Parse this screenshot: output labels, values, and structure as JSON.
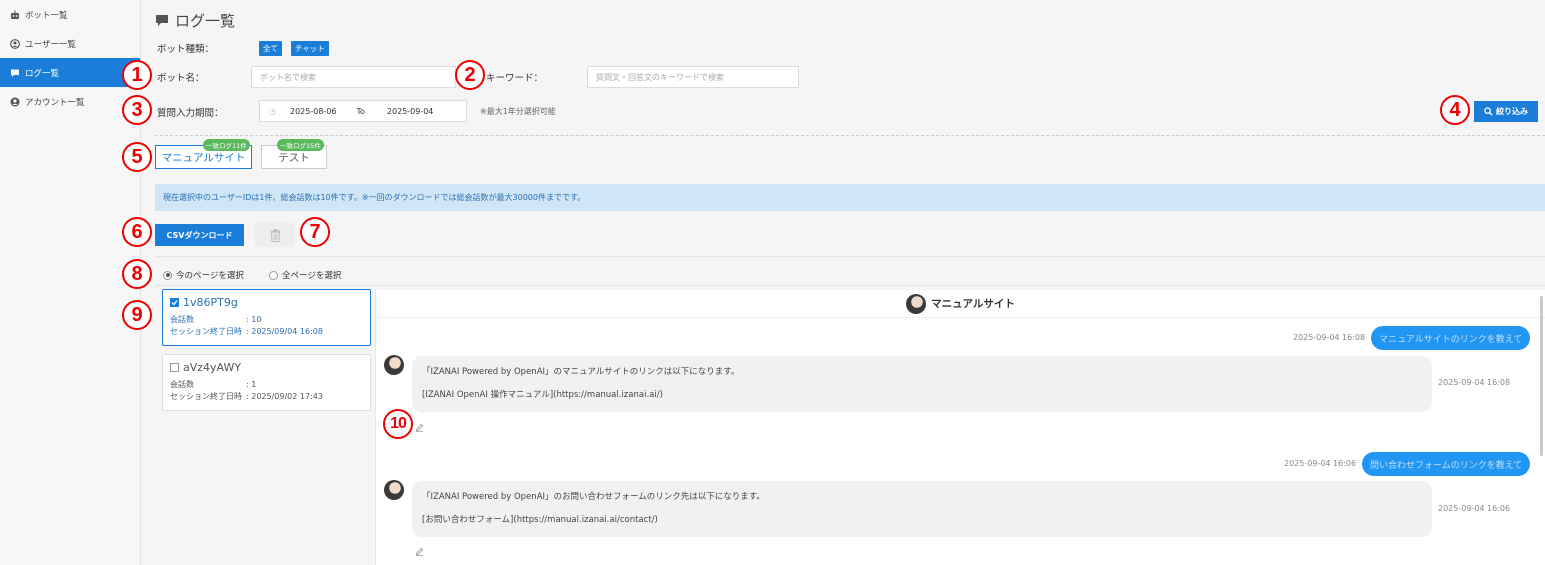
{
  "sidebar": {
    "items": [
      {
        "label": "ボット一覧",
        "icon": "robot-icon"
      },
      {
        "label": "ユーザー一覧",
        "icon": "user-circle-icon"
      },
      {
        "label": "ログ一覧",
        "icon": "comment-icon"
      },
      {
        "label": "アカウント一覧",
        "icon": "account-icon"
      }
    ]
  },
  "header": {
    "title": "ログ一覧"
  },
  "filters": {
    "bot_type_label": "ボット種類：",
    "bot_type_tags": [
      "全て",
      "チャット"
    ],
    "bot_name_label": "ボット名：",
    "bot_name_placeholder": "ボット名で検索",
    "keyword_label": "キーワード：",
    "keyword_placeholder": "質問文・回答文のキーワードで検索",
    "period_label": "質問入力期間：",
    "date_from": "2025-08-06",
    "date_to_word": "To",
    "date_to": "2025-09-04",
    "period_note": "※最大1年分選択可能",
    "search_button": "絞り込み"
  },
  "bot_tabs": [
    {
      "label": "マニュアルサイト",
      "badge": "一致ログ11件"
    },
    {
      "label": "テスト",
      "badge": "一致ログ15件"
    }
  ],
  "info_bar": "現在選択中のユーザーIDは1件、総会話数は10件です。※一回のダウンロードでは総会話数が最大30000件までです。",
  "actions": {
    "csv_button": "CSVダウンロード"
  },
  "selection": {
    "this_page": "今のページを選択",
    "all_pages": "全ページを選択"
  },
  "sessions": [
    {
      "id": "1v86PT9g",
      "count_label": "会話数",
      "count": ": 10",
      "end_label": "セッション終了日時",
      "end": ": 2025/09/04 16:08"
    },
    {
      "id": "aVz4yAWY",
      "count_label": "会話数",
      "count": ": 1",
      "end_label": "セッション終了日時",
      "end": ": 2025/09/02 17:43"
    }
  ],
  "chat": {
    "title": "マニュアルサイト",
    "messages": [
      {
        "user_ts": "2025-09-04 16:08",
        "user_text": "マニュアルサイトのリンクを教えて",
        "bot_line1": "「IZANAI Powered by OpenAI」のマニュアルサイトのリンクは以下になります。",
        "bot_line2": "[IZANAI OpenAI 操作マニュアル](https://manual.izanai.ai/)",
        "bot_ts": "2025-09-04 16:08"
      },
      {
        "user_ts": "2025-09-04 16:06",
        "user_text": "問い合わせフォームのリンクを教えて",
        "bot_line1": "「IZANAI Powered by OpenAI」のお問い合わせフォームのリンク先は以下になります。",
        "bot_line2": "[お問い合わせフォーム](https://manual.izanai.ai/contact/)",
        "bot_ts": "2025-09-04 16:06"
      }
    ]
  },
  "markers": [
    "1",
    "2",
    "3",
    "4",
    "5",
    "6",
    "7",
    "8",
    "9",
    "10"
  ],
  "colors": {
    "primary": "#1a7ed8",
    "badge_green": "#5cb85c",
    "info_bg": "#cfe6f7",
    "marker_red": "#e00000"
  }
}
